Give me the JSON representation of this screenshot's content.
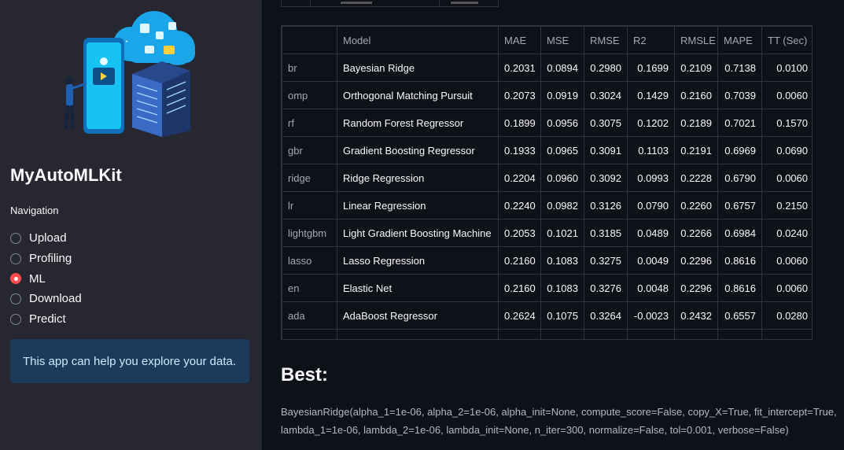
{
  "sidebar": {
    "app_title": "MyAutoMLKit",
    "nav_label": "Navigation",
    "nav_options": [
      {
        "label": "Upload",
        "checked": false
      },
      {
        "label": "Profiling",
        "checked": false
      },
      {
        "label": "ML",
        "checked": true
      },
      {
        "label": "Download",
        "checked": false
      },
      {
        "label": "Predict",
        "checked": false
      }
    ],
    "info_text": "This app can help you explore your data."
  },
  "results": {
    "columns": [
      "",
      "Model",
      "MAE",
      "MSE",
      "RMSE",
      "R2",
      "RMSLE",
      "MAPE",
      "TT (Sec)"
    ],
    "rows": [
      [
        "br",
        "Bayesian Ridge",
        "0.2031",
        "0.0894",
        "0.2980",
        "0.1699",
        "0.2109",
        "0.7138",
        "0.0100"
      ],
      [
        "omp",
        "Orthogonal Matching Pursuit",
        "0.2073",
        "0.0919",
        "0.3024",
        "0.1429",
        "0.2160",
        "0.7039",
        "0.0060"
      ],
      [
        "rf",
        "Random Forest Regressor",
        "0.1899",
        "0.0956",
        "0.3075",
        "0.1202",
        "0.2189",
        "0.7021",
        "0.1570"
      ],
      [
        "gbr",
        "Gradient Boosting Regressor",
        "0.1933",
        "0.0965",
        "0.3091",
        "0.1103",
        "0.2191",
        "0.6969",
        "0.0690"
      ],
      [
        "ridge",
        "Ridge Regression",
        "0.2204",
        "0.0960",
        "0.3092",
        "0.0993",
        "0.2228",
        "0.6790",
        "0.0060"
      ],
      [
        "lr",
        "Linear Regression",
        "0.2240",
        "0.0982",
        "0.3126",
        "0.0790",
        "0.2260",
        "0.6757",
        "0.2150"
      ],
      [
        "lightgbm",
        "Light Gradient Boosting Machine",
        "0.2053",
        "0.1021",
        "0.3185",
        "0.0489",
        "0.2266",
        "0.6984",
        "0.0240"
      ],
      [
        "lasso",
        "Lasso Regression",
        "0.2160",
        "0.1083",
        "0.3275",
        "0.0049",
        "0.2296",
        "0.8616",
        "0.0060"
      ],
      [
        "en",
        "Elastic Net",
        "0.2160",
        "0.1083",
        "0.3276",
        "0.0048",
        "0.2296",
        "0.8616",
        "0.0060"
      ],
      [
        "ada",
        "AdaBoost Regressor",
        "0.2624",
        "0.1075",
        "0.3264",
        "-0.0023",
        "0.2432",
        "0.6557",
        "0.0280"
      ]
    ]
  },
  "best": {
    "title": "Best:",
    "text": "BayesianRidge(alpha_1=1e-06, alpha_2=1e-06, alpha_init=None, compute_score=False, copy_X=True, fit_intercept=True, lambda_1=1e-06, lambda_2=1e-06, lambda_init=None, n_iter=300, normalize=False, tol=0.001, verbose=False)"
  }
}
